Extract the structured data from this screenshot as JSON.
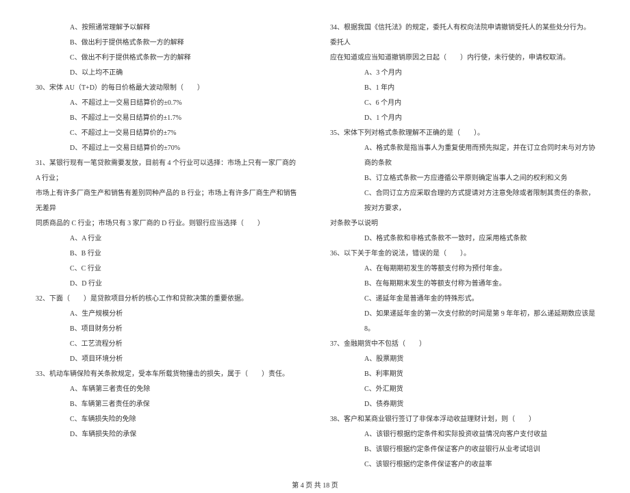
{
  "left": {
    "q29_opts": {
      "A": "A、按照通常理解予以解释",
      "B": "B、做出利于提供格式条款一方的解释",
      "C": "C、做出不利于提供格式条款一方的解释",
      "D": "D、以上均不正确"
    },
    "q30": "30、宋体 AU（T+D）的每日价格最大波动限制（　　）",
    "q30_opts": {
      "A": "A、不超过上一交易日结算价的±0.7%",
      "B": "B、不超过上一交易日结算价的±1.7%",
      "C": "C、不超过上一交易日结算价的±7%",
      "D": "D、不超过上一交易日结算价的±70%"
    },
    "q31_l1": "31、某银行现有一笔贷款需要发放，目前有 4 个行业可以选择：市场上只有一家厂商的 A 行业；",
    "q31_l2": "市场上有许多厂商生产和销售有差别同种产品的 B 行业；市场上有许多厂商生产和销售无差异",
    "q31_l3": "同质商品的 C 行业；市场只有 3 家厂商的 D 行业。则银行应当选择（　　）",
    "q31_opts": {
      "A": "A、A 行业",
      "B": "B、B 行业",
      "C": "C、C 行业",
      "D": "D、D 行业"
    },
    "q32": "32、下面（　　）是贷款项目分析的核心工作和贷款决策的重要依据。",
    "q32_opts": {
      "A": "A、生产规模分析",
      "B": "B、项目财务分析",
      "C": "C、工艺流程分析",
      "D": "D、项目环境分析"
    },
    "q33": "33、机动车辆保险有关条款规定，受本车所载货物撞击的损失，属于（　　）责任。",
    "q33_opts": {
      "A": "A、车辆第三者责任的免除",
      "B": "B、车辆第三者责任的承保",
      "C": "C、车辆损失险的免除",
      "D": "D、车辆损失险的承保"
    }
  },
  "right": {
    "q34_l1": "34、根据我国《信托法》的规定，委托人有权向法院申请撤销受托人的某些处分行为。委托人",
    "q34_l2": "应在知道或应当知道撤销原因之日起（　　）内行使，未行使的，申请权取消。",
    "q34_opts": {
      "A": "A、3 个月内",
      "B": "B、1 年内",
      "C": "C、6 个月内",
      "D": "D、1 个月内"
    },
    "q35": "35、宋体下列对格式条款理解不正确的是（　　）。",
    "q35_opts": {
      "A": "A、格式条款是指当事人为重复使用而预先拟定，并在订立合同时未与对方协商的条款",
      "B": "B、订立格式条款一方应遵循公平原则确定当事人之间的权利和义务",
      "C_l1": "C、合同订立方应采取合理的方式提请对方注意免除或者限制其责任的条款，按对方要求，",
      "C_l2": "对条款予以说明",
      "D": "D、格式条款和非格式条款不一致时，应采用格式条款"
    },
    "q36": "36、以下关于年金的说法，错误的是（　　）。",
    "q36_opts": {
      "A": "A、在每期期初发生的等额支付称为预付年金。",
      "B": "B、在每期期末发生的等额支付称为普通年金。",
      "C": "C、递延年金是普通年金的特殊形式。",
      "D": "D、如果递延年金的第一次支付款的时间是第 9 年年初，那么递延期数应该是 8。"
    },
    "q37": "37、金融期货中不包括（　　）",
    "q37_opts": {
      "A": "A、股票期货",
      "B": "B、利率期货",
      "C": "C、外汇期货",
      "D": "D、债券期货"
    },
    "q38": "38、客户和某商业银行签订了非保本浮动收益理财计划，则（　　）",
    "q38_opts": {
      "A": "A、该银行根据约定条件和实际投资收益情况向客户支付收益",
      "B": "B、该银行根据约定条件保证客户的收益银行从业考试培训",
      "C": "C、该银行根据约定条件保证客户的收益率"
    }
  },
  "footer": "第 4 页 共 18 页"
}
